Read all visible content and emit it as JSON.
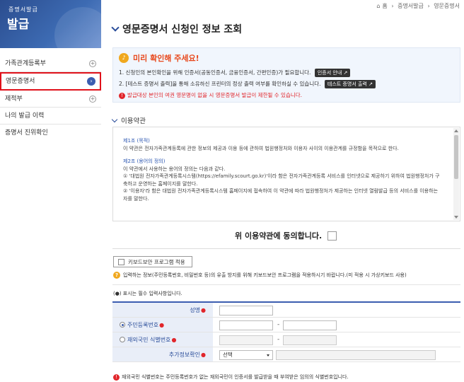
{
  "sidebar": {
    "banner_line1": "증명서발급",
    "banner_line2": "발급",
    "items": [
      {
        "label": "가족관계등록부",
        "marker": "+"
      },
      {
        "label": "영문증명서",
        "marker": "›"
      },
      {
        "label": "제적부",
        "marker": "+"
      },
      {
        "label": "나의 발급 이력",
        "marker": ""
      },
      {
        "label": "증명서 진위확인",
        "marker": ""
      }
    ]
  },
  "breadcrumb": {
    "home_icon": "⌂",
    "home": "홈",
    "sep": "›",
    "level1": "증명서발급",
    "level2": "영문증명서"
  },
  "page": {
    "title": "영문증명서 신청인 정보 조회"
  },
  "notice": {
    "title": "미리 확인해 주세요!",
    "line1": "1. 신청인의 본인확인을 위해 인증서(공동인증서, 금융인증서, 간편인증)가 필요합니다.",
    "line1_button": "인증서 안내 ↗",
    "line2": "2. [테스트 증명서 출력]을 통해 소유하신 프린터의 정상 출력 여부를 확인하실 수 있습니다.",
    "line2_button": "테스트 증명서 출력 ↗",
    "warning": "발급대상 본인의 여권 영문명이 없을 시 영문증명서 발급이 제한될 수 있습니다."
  },
  "terms": {
    "heading": "이용약관",
    "art1_title": "제1조 (목적)",
    "art1_body": "이 약관은 전자가족관계등록에 관한 정보의 제공과 이용 등에 관하여 법원행정처와 이용자 사이의 이용관계를 규정함을 목적으로 한다.",
    "art2_title": "제2조 (용어의 정의)",
    "art2_intro": "이 약관에서 사용하는 용어의 정의는 다음과 같다.",
    "art2_item1": "① '대법원 전자가족관계등록시스템(https://efamily.scourt.go.kr)'이라 함은 전자가족관계등록 서비스를 인터넷으로 제공하기 위하여 법원행정처가 구축하고 운영하는 홈페이지를 말한다.",
    "art2_item2": "② '이용자'라 함은 대법원 전자가족관계등록시스템 홈페이지에 접속하여 이 약관에 따라 법원행정처가 제공하는 인터넷 열람발급 등의 서비스를 이용하는 자를 말한다.",
    "agree_label": "위 이용약관에 동의합니다."
  },
  "keyboard_security": {
    "label": "키보드보안 프로그램 적용",
    "hint": "입력하는 정보(주민등록번호, 비밀번호 등)의 유출 방지를 위해 키보드보안 프로그램을 적용하시기 바랍니다.(미 적용 시 가상키보드 사용)"
  },
  "form": {
    "required_note": "(●) 표시는 필수 입력사항입니다.",
    "name_label": "성명",
    "rrn_label": "주민등록번호",
    "foreign_label": "재외국민 식별번호",
    "extra_label": "추가정보확인",
    "select_value": "선택",
    "star": "●"
  },
  "footnote": "재외국민 식별번호는 주민등록번호가 없는 재외국민이 인증서를 발급받을 때 부여받은 임의의 식별번호입니다."
}
